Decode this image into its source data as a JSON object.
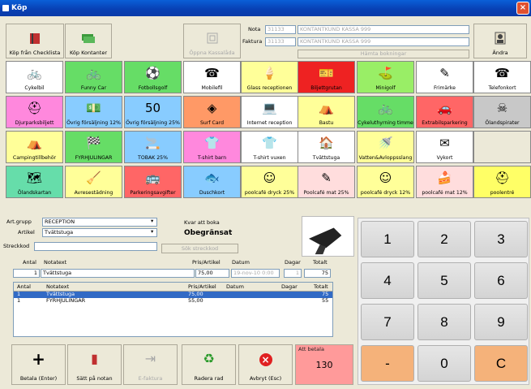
{
  "window": {
    "title": "Köp",
    "close_label": "×"
  },
  "toolbar": {
    "btn1": "Köp från Checklista",
    "btn2": "Köp Kontanter",
    "btn3": "Öppna Kassalåda",
    "edit": "Ändra",
    "nota_label": "Nota",
    "nota_value": "31133",
    "nota_name": "KONTANTKUND KASSA 999",
    "faktura_label": "Faktura",
    "faktura_value": "31133",
    "faktura_name": "KONTANTKUND KASSA 999",
    "hamta": "Hämta bokningar"
  },
  "products": [
    {
      "label": "Cykelbil",
      "icon": "🚲",
      "bg": "#ffffff"
    },
    {
      "label": "Funny Car",
      "icon": "🚲",
      "bg": "#66dd66"
    },
    {
      "label": "Fotbollsgolf",
      "icon": "⚽",
      "bg": "#66dd66"
    },
    {
      "label": "Mobilefil",
      "icon": "☎",
      "bg": "#ffffff"
    },
    {
      "label": "Glass receptionen",
      "icon": "🍦",
      "bg": "#ffff99"
    },
    {
      "label": "Biljettgrutan",
      "icon": "🎫",
      "bg": "#ee2222"
    },
    {
      "label": "Minigolf",
      "icon": "⛳",
      "bg": "#99ee66"
    },
    {
      "label": "Frimärke",
      "icon": "✎",
      "bg": "#ffffff"
    },
    {
      "label": "Telefonkort",
      "icon": "☎",
      "bg": "#ffffff"
    },
    {
      "label": "Djurparksbiljett",
      "icon": "⛑",
      "bg": "#ff88dd"
    },
    {
      "label": "Övrig försäljning 12%",
      "icon": "💵",
      "bg": "#88ccff"
    },
    {
      "label": "Övrig försäljning 25%",
      "icon": "50",
      "bg": "#88ccff"
    },
    {
      "label": "Surf Card",
      "icon": "◈",
      "bg": "#ff9966"
    },
    {
      "label": "Internet reception",
      "icon": "💻",
      "bg": "#ffffff"
    },
    {
      "label": "Bastu",
      "icon": "⛺",
      "bg": "#ffff99"
    },
    {
      "label": "Cykeluthyrning timme",
      "icon": "🚲",
      "bg": "#66dd66"
    },
    {
      "label": "Extrabilsparkering",
      "icon": "🚗",
      "bg": "#ff6666"
    },
    {
      "label": "Ölandspirater",
      "icon": "☠",
      "bg": "#c8c8c8"
    },
    {
      "label": "Campingtillbehör",
      "icon": "⛺",
      "bg": "#ffff99"
    },
    {
      "label": "FYRHJULINGAR",
      "icon": "🏁",
      "bg": "#66dd66"
    },
    {
      "label": "TOBAK 25%",
      "icon": "🚬",
      "bg": "#88ccff"
    },
    {
      "label": "T-shirt barn",
      "icon": "👕",
      "bg": "#ff88dd"
    },
    {
      "label": "T-shirt vuxen",
      "icon": "👕",
      "bg": "#ffffff"
    },
    {
      "label": "Tvättstuga",
      "icon": "🏠",
      "bg": "#ffffff"
    },
    {
      "label": "Vatten&Avloppsslang",
      "icon": "🚿",
      "bg": "#ffff99"
    },
    {
      "label": "Vykort",
      "icon": "✉",
      "bg": "#ffffff"
    },
    {
      "label": "",
      "icon": "",
      "bg": "#ece9d8"
    },
    {
      "label": "Ölandskartan",
      "icon": "🗺",
      "bg": "#66ddaa"
    },
    {
      "label": "Avresestädning",
      "icon": "🧹",
      "bg": "#ffff99"
    },
    {
      "label": "Parkeringsavgifter",
      "icon": "🚌",
      "bg": "#ff6666"
    },
    {
      "label": "Duschkort",
      "icon": "🐟",
      "bg": "#88ccff"
    },
    {
      "label": "poolcafé dryck 25%",
      "icon": "☺",
      "bg": "#ffff99"
    },
    {
      "label": "Poolcafé mat 25%",
      "icon": "✎",
      "bg": "#ffdddd"
    },
    {
      "label": "poolcafé dryck 12%",
      "icon": "☺",
      "bg": "#ffff99"
    },
    {
      "label": "poolcafé mat 12%",
      "icon": "🍰",
      "bg": "#ffdddd"
    },
    {
      "label": "poolentré",
      "icon": "⛑",
      "bg": "#ffff66"
    }
  ],
  "form": {
    "artgrupp_label": "Art.grupp",
    "artgrupp_value": "RECEPTION",
    "artikel_label": "Artikel",
    "artikel_value": "Tvättstuga",
    "streckkod_label": "Streckkod",
    "streckkod_value": "",
    "kvar_label": "Kvar att boka",
    "kvar_value": "Obegränsat",
    "sok_button": "Sök streckkod",
    "antal_label": "Antal",
    "notatext_label": "Notatext",
    "pris_label": "Pris/Artikel",
    "datum_label": "Datum",
    "dagar_label": "Dagar",
    "totalt_label": "Totalt",
    "antal_value": "1",
    "notatext_value": "Tvättstuga",
    "pris_value": "75,00",
    "datum_value": "19-nov-10  0:00",
    "dagar_value": "1",
    "totalt_value": "75"
  },
  "table": {
    "headers": [
      "Antal",
      "Notatext",
      "Pris/Artikel",
      "Datum",
      "Dagar",
      "Totalt"
    ],
    "rows": [
      {
        "antal": "1",
        "notatext": "Tvättstuga",
        "pris": "75,00",
        "datum": "",
        "dagar": "",
        "totalt": "75"
      },
      {
        "antal": "1",
        "notatext": "FYRHJULINGAR",
        "pris": "55,00",
        "datum": "",
        "dagar": "",
        "totalt": "55"
      }
    ]
  },
  "bottom": {
    "btn1": "Betala (Enter)",
    "btn2": "Sätt på notan",
    "btn3": "E-faktura",
    "btn4": "Radera rad",
    "btn5": "Avbryt (Esc)",
    "att_betala_label": "Att betala",
    "att_betala_value": "130"
  },
  "keypad": [
    "1",
    "2",
    "3",
    "4",
    "5",
    "6",
    "7",
    "8",
    "9",
    "-",
    "0",
    "C"
  ]
}
